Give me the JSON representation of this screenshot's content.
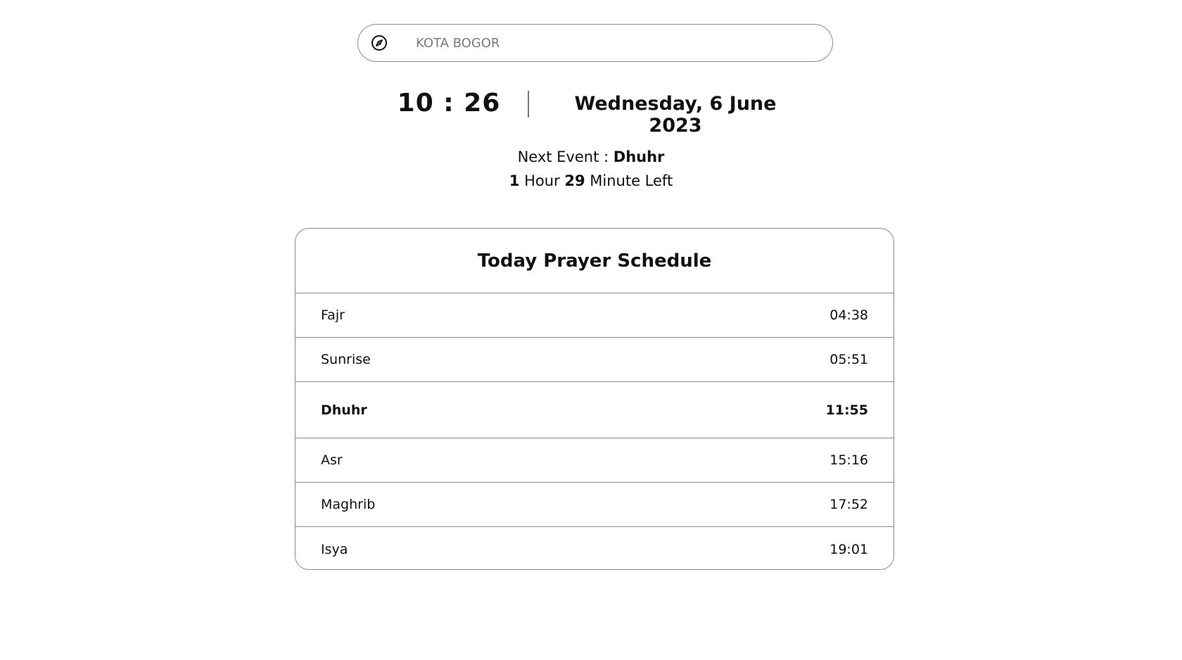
{
  "search": {
    "icon": "compass-icon",
    "value": "",
    "placeholder": "KOTA BOGOR"
  },
  "clock": {
    "time": "10 : 26",
    "date": "Wednesday, 6 June 2023"
  },
  "next_event": {
    "prefix": "Next Event : ",
    "name": "Dhuhr",
    "hours": "1",
    "hour_label": " Hour ",
    "minutes": "29",
    "minute_label": " Minute Left"
  },
  "schedule": {
    "title": "Today Prayer Schedule",
    "rows": [
      {
        "name": "Fajr",
        "time": "04:38",
        "active": false
      },
      {
        "name": "Sunrise",
        "time": "05:51",
        "active": false
      },
      {
        "name": "Dhuhr",
        "time": "11:55",
        "active": true
      },
      {
        "name": "Asr",
        "time": "15:16",
        "active": false
      },
      {
        "name": "Maghrib",
        "time": "17:52",
        "active": false
      },
      {
        "name": "Isya",
        "time": "19:01",
        "active": false
      }
    ]
  }
}
